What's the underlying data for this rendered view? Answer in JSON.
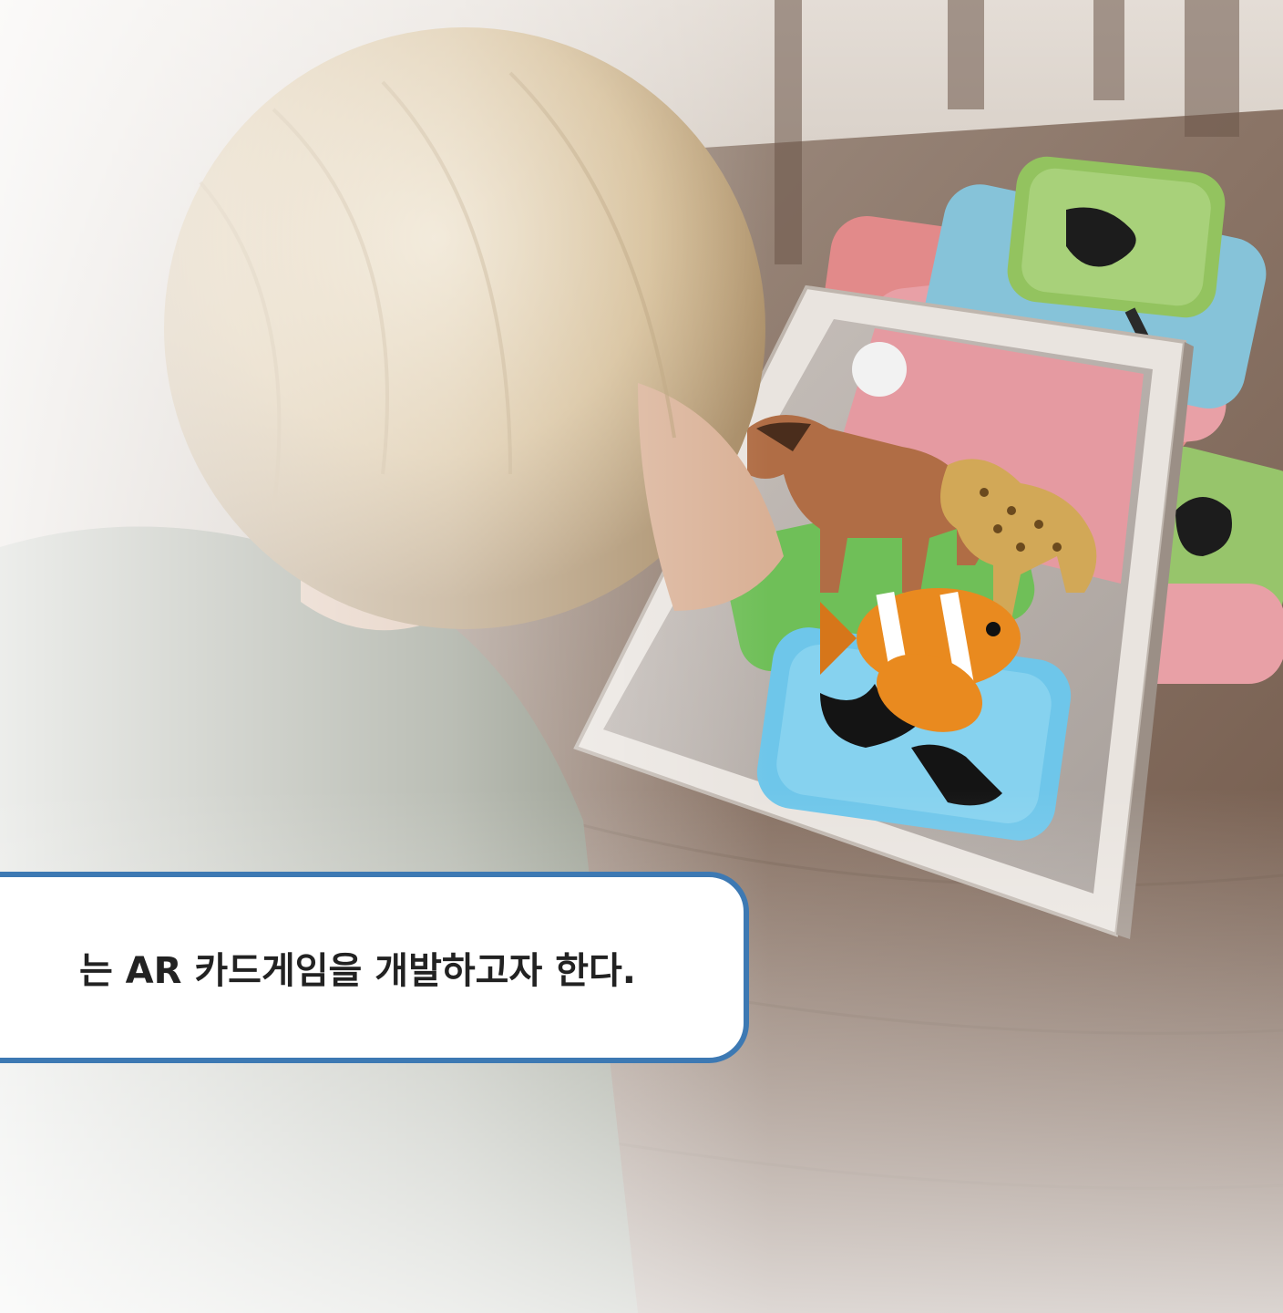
{
  "caption": {
    "text": "는 AR 카드게임을 개발하고자 한다."
  },
  "colors": {
    "caption_border": "#3d79b3",
    "caption_background": "#ffffff",
    "caption_text": "#222222"
  },
  "scene": {
    "description_icons": [
      "child-figure",
      "tablet-device",
      "ar-animal-cards",
      "horse-model",
      "leopard-model",
      "clownfish-model"
    ]
  }
}
